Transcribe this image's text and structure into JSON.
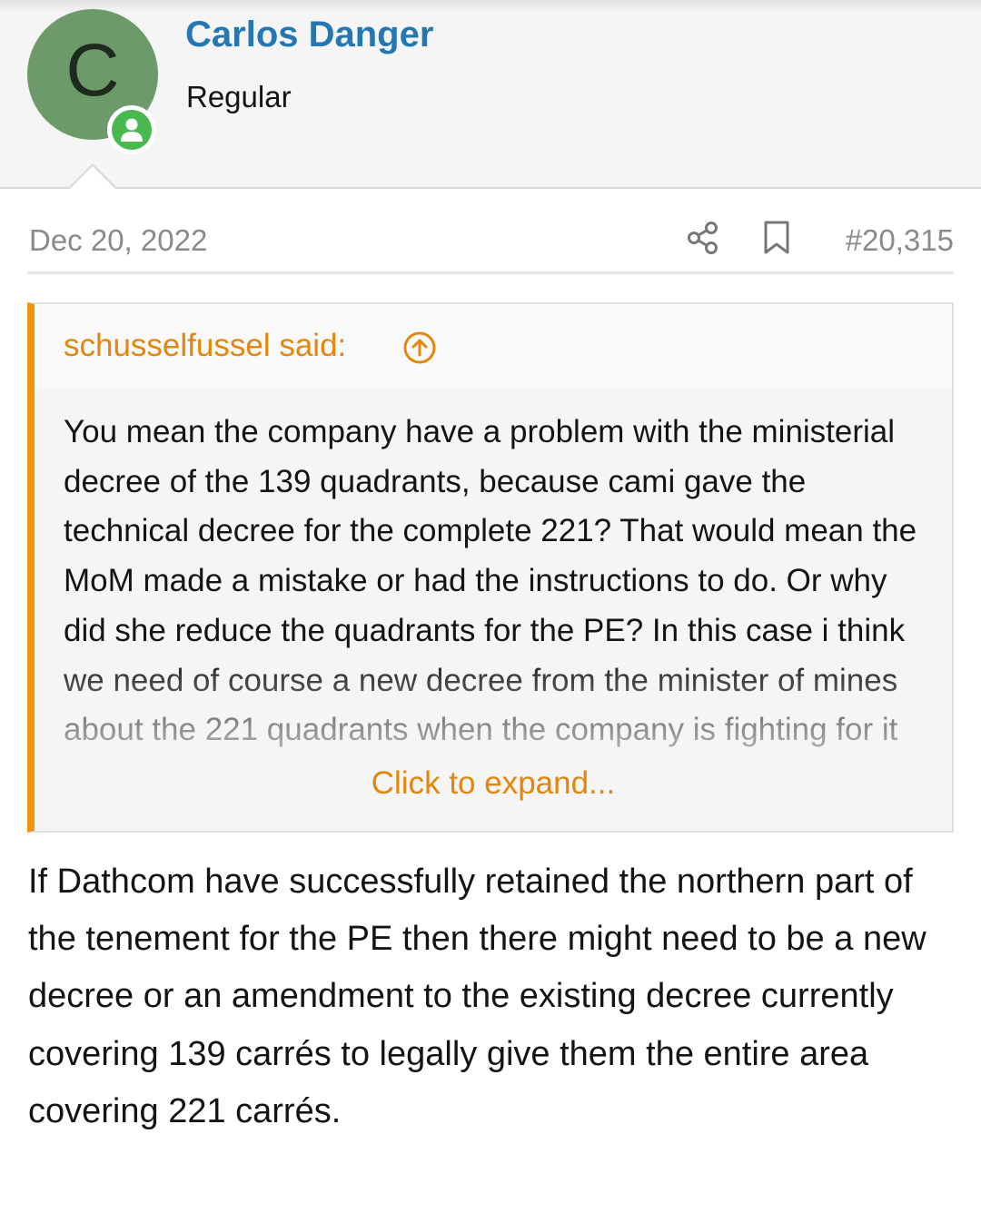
{
  "user": {
    "avatar_letter": "C",
    "avatar_color": "#6c9a6a",
    "online_status_color": "#49b84e",
    "online_icon": "person-icon",
    "name": "Carlos Danger",
    "title": "Regular",
    "name_color": "#2577b1"
  },
  "meta": {
    "date": "Dec 20, 2022",
    "share_icon": "share-icon",
    "bookmark_icon": "bookmark-icon",
    "post_number": "#20,315"
  },
  "quote": {
    "accent_color": "#f0960e",
    "author_label": "schusselfussel said:",
    "jump_icon": "arrow-up-circle-icon",
    "text": "You mean the company have a problem with the ministerial decree of the 139 quadrants, because cami gave the technical decree for the complete 221? That would mean the MoM made a mistake or had the instructions to do. Or why did she reduce the quadrants for the PE? In this case i think we need of course a new decree from the minister of mines about the 221 quadrants when the company is fighting for it",
    "expand_label": "Click to expand..."
  },
  "reply": {
    "text": "If Dathcom have successfully retained the northern part of the tenement for the PE then there might need to be a new decree or an amendment to the existing decree currently covering 139 carrés to legally give them the entire area covering 221 carrés."
  }
}
